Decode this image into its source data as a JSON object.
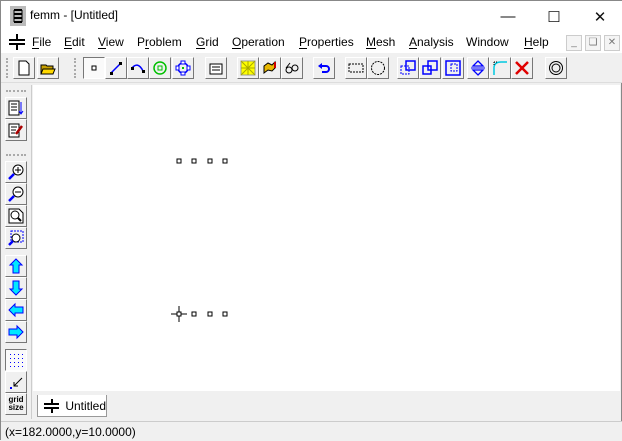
{
  "window": {
    "title": "femm - [Untitled]",
    "app_icon": "femm-coil-icon"
  },
  "menu": [
    "File",
    "Edit",
    "View",
    "Problem",
    "Grid",
    "Operation",
    "Properties",
    "Mesh",
    "Analysis",
    "Window",
    "Help"
  ],
  "menu_underline": [
    "F",
    "E",
    "V",
    "r",
    "G",
    "O",
    "P",
    "M",
    "A",
    "",
    "H"
  ],
  "toolbar": [
    {
      "name": "new-document",
      "icon": "new-file-icon"
    },
    {
      "name": "open-file",
      "icon": "open-folder-icon"
    },
    {
      "name": "operate-on-nodes",
      "icon": "node-icon",
      "pressed": true
    },
    {
      "name": "operate-on-segments",
      "icon": "segment-icon"
    },
    {
      "name": "operate-on-arcs",
      "icon": "arc-icon"
    },
    {
      "name": "operate-on-block-labels",
      "icon": "block-label-icon"
    },
    {
      "name": "operate-on-groups",
      "icon": "group-icon"
    },
    {
      "name": "problem-properties",
      "icon": "properties-icon"
    },
    {
      "name": "create-mesh",
      "icon": "mesh-icon"
    },
    {
      "name": "run-analysis",
      "icon": "run-icon"
    },
    {
      "name": "view-results",
      "icon": "glasses-icon"
    },
    {
      "name": "undo",
      "icon": "undo-icon"
    },
    {
      "name": "select-rectangle",
      "icon": "rect-select-icon"
    },
    {
      "name": "select-circle",
      "icon": "circle-select-icon"
    },
    {
      "name": "copy",
      "icon": "copy-icon"
    },
    {
      "name": "move",
      "icon": "move-icon"
    },
    {
      "name": "scale",
      "icon": "scale-icon"
    },
    {
      "name": "mirror",
      "icon": "mirror-icon"
    },
    {
      "name": "fillet",
      "icon": "fillet-icon"
    },
    {
      "name": "delete",
      "icon": "delete-icon"
    },
    {
      "name": "create-open-boundary",
      "icon": "open-boundary-icon"
    }
  ],
  "left_toolbar": [
    {
      "name": "show-names",
      "icon": "list-arrow-icon"
    },
    {
      "name": "edit-notes",
      "icon": "notepad-pencil-icon"
    },
    {
      "name": "zoom-in",
      "icon": "zoom-in-icon"
    },
    {
      "name": "zoom-out",
      "icon": "zoom-out-icon"
    },
    {
      "name": "zoom-natural",
      "icon": "zoom-page-icon"
    },
    {
      "name": "zoom-window",
      "icon": "zoom-window-icon"
    },
    {
      "name": "pan-up",
      "icon": "arrow-up-icon"
    },
    {
      "name": "pan-down",
      "icon": "arrow-down-icon"
    },
    {
      "name": "pan-left",
      "icon": "arrow-left-icon"
    },
    {
      "name": "pan-right",
      "icon": "arrow-right-icon"
    },
    {
      "name": "show-grid",
      "icon": "grid-dots-icon",
      "pressed": true
    },
    {
      "name": "snap-grid",
      "icon": "snap-arrow-icon"
    },
    {
      "name": "grid-size",
      "icon": "grid-size-icon",
      "label": "grid\nsize"
    }
  ],
  "tab": {
    "label": "Untitled"
  },
  "status": {
    "text": "(x=182.0000,y=10.0000)"
  },
  "colors": {
    "accent_blue": "#0000ff",
    "green": "#00c000"
  }
}
